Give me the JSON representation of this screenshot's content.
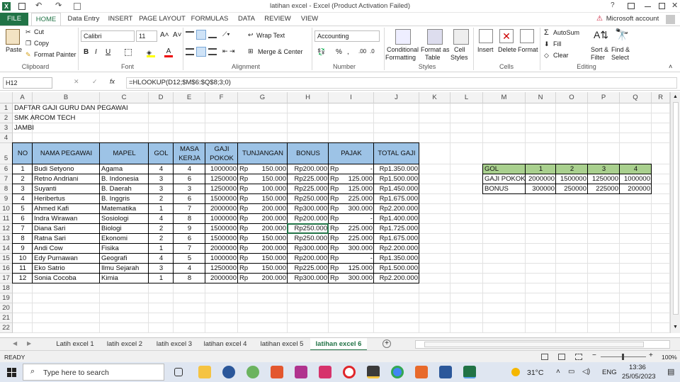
{
  "window": {
    "title": "latihan excel - Excel (Product Activation Failed)",
    "help": "?"
  },
  "ribbon": {
    "tabs": [
      "FILE",
      "HOME",
      "Data Entry",
      "INSERT",
      "PAGE LAYOUT",
      "FORMULAS",
      "DATA",
      "REVIEW",
      "VIEW"
    ],
    "account": "Microsoft account",
    "clipboard": {
      "paste": "Paste",
      "cut": "Cut",
      "copy": "Copy",
      "format_painter": "Format Painter",
      "label": "Clipboard"
    },
    "font": {
      "name": "Calibri",
      "size": "11",
      "bold": "B",
      "italic": "I",
      "underline": "U",
      "label": "Font"
    },
    "alignment": {
      "wrap": "Wrap Text",
      "merge": "Merge & Center",
      "label": "Alignment"
    },
    "number": {
      "format": "Accounting",
      "percent": "%",
      "label": "Number"
    },
    "styles": {
      "conditional": "Conditional",
      "conditional2": "Formatting",
      "format_as": "Format as",
      "format_as2": "Table",
      "cell": "Cell",
      "cell2": "Styles",
      "label": "Styles"
    },
    "cells": {
      "insert": "Insert",
      "delete": "Delete",
      "format": "Format",
      "label": "Cells"
    },
    "editing": {
      "autosum": "AutoSum",
      "fill": "Fill",
      "clear": "Clear",
      "sort": "Sort &",
      "sort2": "Filter",
      "find": "Find &",
      "find2": "Select",
      "label": "Editing"
    }
  },
  "formula_bar": {
    "name_box": "H12",
    "fx": "fx",
    "formula": "=HLOOKUP(D12;$M$6:$Q$8;3;0)"
  },
  "columns": [
    "A",
    "B",
    "C",
    "D",
    "E",
    "F",
    "G",
    "H",
    "I",
    "J",
    "K",
    "L",
    "M",
    "N",
    "O",
    "P",
    "Q",
    "R"
  ],
  "rows": [
    "1",
    "2",
    "3",
    "4",
    "5",
    "6",
    "7",
    "8",
    "9",
    "10",
    "11",
    "12",
    "13",
    "14",
    "15",
    "16",
    "17",
    "18",
    "19",
    "20",
    "21",
    "22",
    "23"
  ],
  "header_text": [
    "DAFTAR GAJI GURU DAN PEGAWAI",
    "SMK ARCOM TECH",
    "JAMBI"
  ],
  "table_headers": [
    "NO",
    "NAMA PEGAWAI",
    "MAPEL",
    "GOL",
    "MASA",
    "KERJA",
    "GAJI",
    "POKOK",
    "TUNJANGAN",
    "BONUS",
    "PAJAK",
    "TOTAL GAJI"
  ],
  "table_rows": [
    [
      "1",
      "Budi Setyono",
      "Agama",
      "4",
      "4",
      "1000000",
      "Rp",
      "150.000",
      "Rp200.000",
      "Rp",
      "-",
      "Rp1.350.000"
    ],
    [
      "2",
      "Retno Andriani",
      "B. Indonesia",
      "3",
      "6",
      "1250000",
      "Rp",
      "150.000",
      "Rp225.000",
      "Rp",
      "125.000",
      "Rp1.500.000"
    ],
    [
      "3",
      "Suyanti",
      "B. Daerah",
      "3",
      "3",
      "1250000",
      "Rp",
      "100.000",
      "Rp225.000",
      "Rp",
      "125.000",
      "Rp1.450.000"
    ],
    [
      "4",
      "Heribertus",
      "B. Inggris",
      "2",
      "6",
      "1500000",
      "Rp",
      "150.000",
      "Rp250.000",
      "Rp",
      "225.000",
      "Rp1.675.000"
    ],
    [
      "5",
      "Ahmed Kafi",
      "Matematika",
      "1",
      "7",
      "2000000",
      "Rp",
      "200.000",
      "Rp300.000",
      "Rp",
      "300.000",
      "Rp2.200.000"
    ],
    [
      "6",
      "Indra Wirawan",
      "Sosiologi",
      "4",
      "8",
      "1000000",
      "Rp",
      "200.000",
      "Rp200.000",
      "Rp",
      "-",
      "Rp1.400.000"
    ],
    [
      "7",
      "Diana Sari",
      "Biologi",
      "2",
      "9",
      "1500000",
      "Rp",
      "200.000",
      "Rp250.000",
      "Rp",
      "225.000",
      "Rp1.725.000"
    ],
    [
      "8",
      "Ratna Sari",
      "Ekonomi",
      "2",
      "6",
      "1500000",
      "Rp",
      "150.000",
      "Rp250.000",
      "Rp",
      "225.000",
      "Rp1.675.000"
    ],
    [
      "9",
      "Andi Cow",
      "Fisika",
      "1",
      "7",
      "2000000",
      "Rp",
      "200.000",
      "Rp300.000",
      "Rp",
      "300.000",
      "Rp2.200.000"
    ],
    [
      "10",
      "Edy Purnawan",
      "Geografi",
      "4",
      "5",
      "1000000",
      "Rp",
      "150.000",
      "Rp200.000",
      "Rp",
      "-",
      "Rp1.350.000"
    ],
    [
      "11",
      "Eko Satrio",
      "Ilmu Sejarah",
      "3",
      "4",
      "1250000",
      "Rp",
      "150.000",
      "Rp225.000",
      "Rp",
      "125.000",
      "Rp1.500.000"
    ],
    [
      "12",
      "Sonia Cocoba",
      "Kimia",
      "1",
      "8",
      "2000000",
      "Rp",
      "200.000",
      "Rp300.000",
      "Rp",
      "300.000",
      "Rp2.200.000"
    ]
  ],
  "lookup": {
    "labels": [
      "GOL",
      "GAJI POKOK",
      "BONUS"
    ],
    "gol": [
      "1",
      "2",
      "3",
      "4"
    ],
    "gaji": [
      "2000000",
      "1500000",
      "1250000",
      "1000000"
    ],
    "bonus": [
      "300000",
      "250000",
      "225000",
      "200000"
    ]
  },
  "sheet_tabs": [
    "Latih excel 1",
    "latih excel 2",
    "latih excel 3",
    "latihan excel 4",
    "latihan excel 5",
    "latihan excel 6"
  ],
  "status": {
    "ready": "READY",
    "zoom": "100%"
  },
  "taskbar": {
    "search": "Type here to search",
    "temp": "31°C",
    "lang": "ENG",
    "time": "13:36",
    "date": "25/05/2023"
  },
  "colors": {
    "file_tab": "#217346",
    "header_fill": "#9dc3e6",
    "lookup_fill": "#a9d08e"
  }
}
